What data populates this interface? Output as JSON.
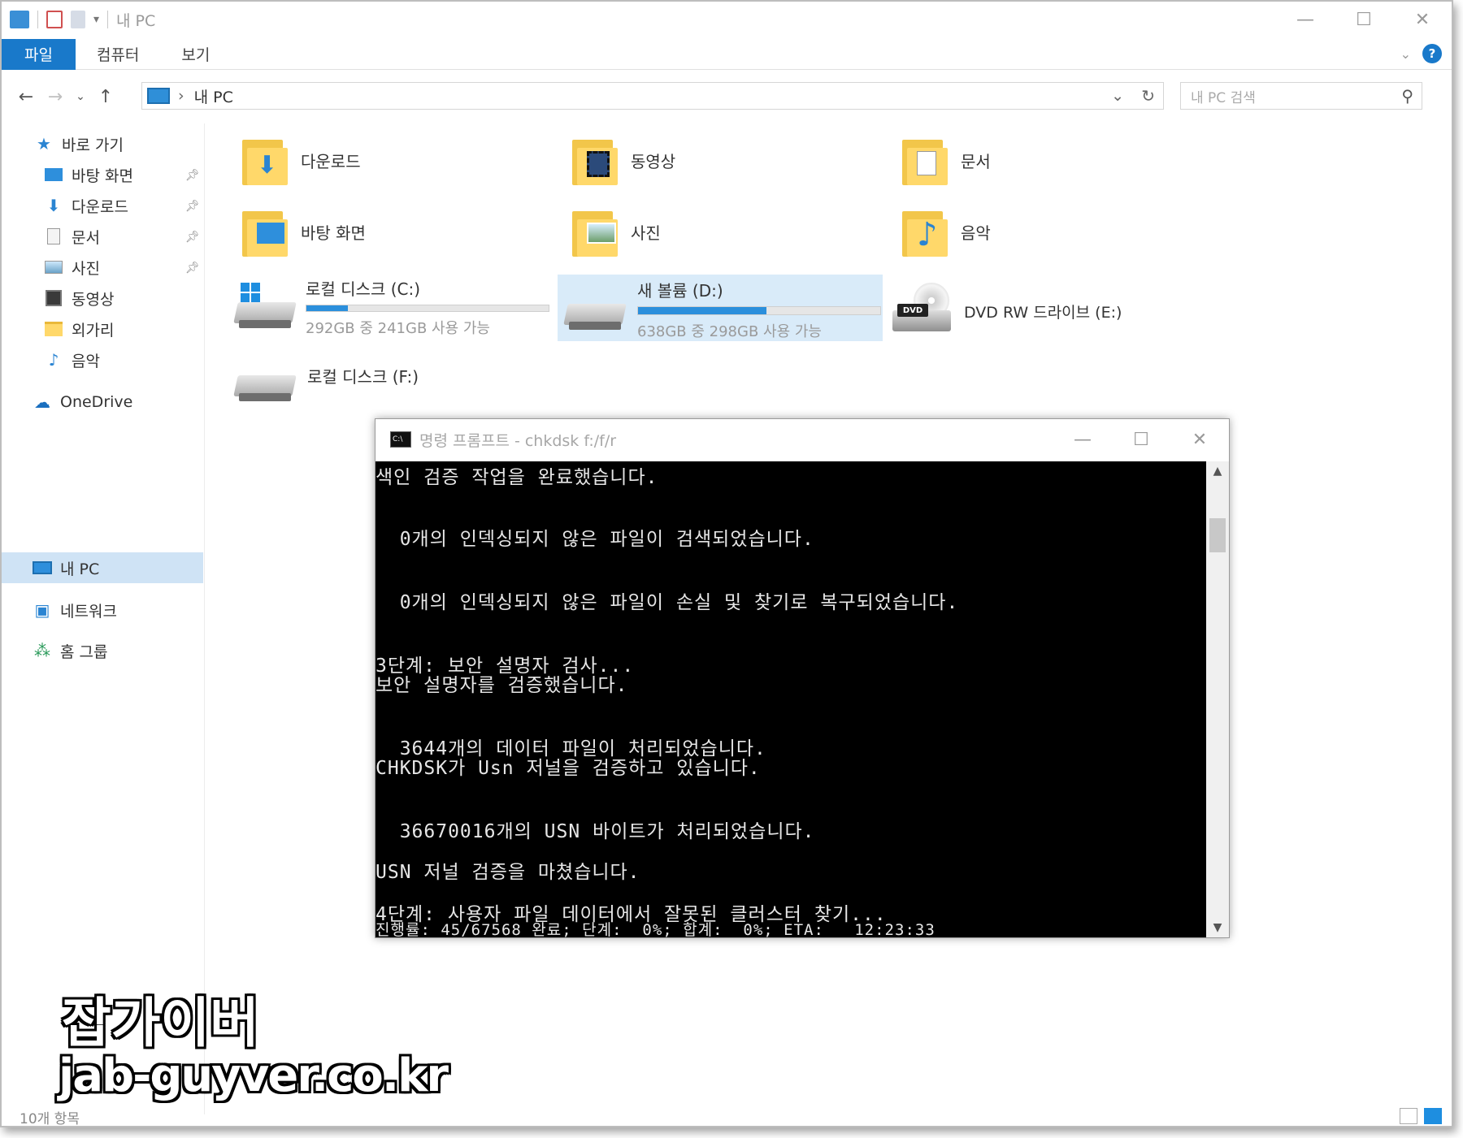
{
  "window": {
    "title": "내 PC",
    "controls": {
      "minimize": "—",
      "maximize": "☐",
      "close": "✕"
    }
  },
  "ribbon": {
    "tabs": [
      "파일",
      "컴퓨터",
      "보기"
    ],
    "help": "?"
  },
  "address": {
    "location": "내 PC",
    "search_placeholder": "내 PC 검색"
  },
  "sidebar": {
    "items": [
      {
        "label": "바로 가기",
        "icon": "star-icon",
        "pinned": false
      },
      {
        "label": "바탕 화면",
        "icon": "desktop-icon",
        "pinned": true
      },
      {
        "label": "다운로드",
        "icon": "download-icon",
        "pinned": true
      },
      {
        "label": "문서",
        "icon": "document-icon",
        "pinned": true
      },
      {
        "label": "사진",
        "icon": "picture-icon",
        "pinned": true
      },
      {
        "label": "동영상",
        "icon": "video-icon",
        "pinned": false
      },
      {
        "label": "외가리",
        "icon": "folder-icon",
        "pinned": false
      },
      {
        "label": "음악",
        "icon": "music-icon",
        "pinned": false
      },
      {
        "label": "OneDrive",
        "icon": "cloud-icon",
        "pinned": false
      },
      {
        "label": "내 PC",
        "icon": "computer-icon",
        "pinned": false,
        "selected": true
      },
      {
        "label": "네트워크",
        "icon": "network-icon",
        "pinned": false
      },
      {
        "label": "홈 그룹",
        "icon": "homegroup-icon",
        "pinned": false
      }
    ]
  },
  "folders": [
    {
      "label": "다운로드",
      "icon": "download-icon"
    },
    {
      "label": "동영상",
      "icon": "video-icon"
    },
    {
      "label": "문서",
      "icon": "document-icon"
    },
    {
      "label": "바탕 화면",
      "icon": "desktop-icon"
    },
    {
      "label": "사진",
      "icon": "picture-icon"
    },
    {
      "label": "음악",
      "icon": "music-icon"
    }
  ],
  "drives": [
    {
      "name": "로컬 디스크 (C:)",
      "free": "292GB 중 241GB 사용 가능",
      "used_fraction": 0.17,
      "windows": true
    },
    {
      "name": "새 볼륨 (D:)",
      "free": "638GB 중 298GB 사용 가능",
      "used_fraction": 0.53,
      "selected": true
    },
    {
      "name": "DVD RW 드라이브 (E:)"
    },
    {
      "name": "로컬 디스크 (F:)"
    }
  ],
  "cmd": {
    "title": "명령 프롬프트 - chkdsk  f:/f/r",
    "icon_text": "C:\\",
    "lines": [
      "색인 검증 작업을 완료했습니다.",
      "  0개의 인덱싱되지 않은 파일이 검색되었습니다.",
      "  0개의 인덱싱되지 않은 파일이 손실 및 찾기로 복구되었습니다.",
      "3단계: 보안 설명자 검사...",
      "보안 설명자를 검증했습니다.",
      "  3644개의 데이터 파일이 처리되었습니다.",
      "CHKDSK가 Usn 저널을 검증하고 있습니다.",
      "  36670016개의 USN 바이트가 처리되었습니다.",
      "USN 저널 검증을 마쳤습니다.",
      "4단계: 사용자 파일 데이터에서 잘못된 클러스터 찾기...",
      "진행률: 45/67568 완료; 단계:  0%; 합계:  0%; ETA:   12:23:33"
    ]
  },
  "watermark": {
    "korean": "잡가이버",
    "url": "jab-guyver.co.kr"
  },
  "status": {
    "item_count": "10개 항목"
  },
  "colors": {
    "accent": "#1979ca",
    "folder": "#ffd86a",
    "drive_bar": "#2b8fdc",
    "selection": "#d9ebf9"
  }
}
